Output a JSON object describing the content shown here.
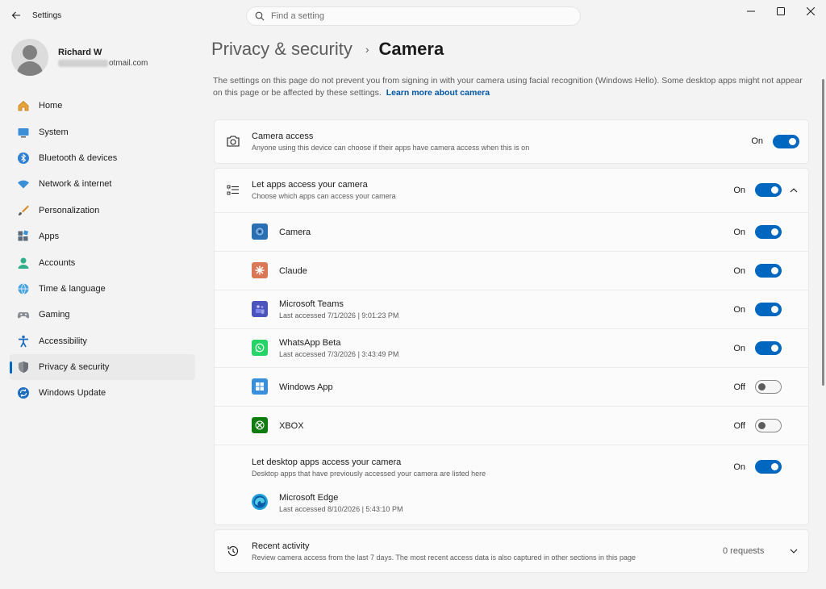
{
  "window": {
    "title": "Settings",
    "search_placeholder": "Find a setting"
  },
  "profile": {
    "name": "Richard W",
    "email_visible": "otmail.com"
  },
  "sidebar": {
    "items": [
      {
        "label": "Home",
        "icon": "home-icon"
      },
      {
        "label": "System",
        "icon": "monitor-icon"
      },
      {
        "label": "Bluetooth & devices",
        "icon": "bluetooth-icon"
      },
      {
        "label": "Network & internet",
        "icon": "wifi-icon"
      },
      {
        "label": "Personalization",
        "icon": "brush-icon"
      },
      {
        "label": "Apps",
        "icon": "apps-icon"
      },
      {
        "label": "Accounts",
        "icon": "accounts-icon"
      },
      {
        "label": "Time & language",
        "icon": "globe-icon"
      },
      {
        "label": "Gaming",
        "icon": "gamepad-icon"
      },
      {
        "label": "Accessibility",
        "icon": "accessibility-icon"
      },
      {
        "label": "Privacy & security",
        "icon": "shield-icon",
        "active": true
      },
      {
        "label": "Windows Update",
        "icon": "update-icon"
      }
    ]
  },
  "header": {
    "parent": "Privacy & security",
    "separator": "›",
    "current": "Camera"
  },
  "description": {
    "text": "The settings on this page do not prevent you from signing in with your camera using facial recognition (Windows Hello). Some desktop apps might not appear on this page or be affected by these settings.",
    "link": "Learn more about camera"
  },
  "camera_access": {
    "title": "Camera access",
    "desc": "Anyone using this device can choose if their apps have camera access when this is on",
    "state": "On"
  },
  "let_apps": {
    "title": "Let apps access your camera",
    "desc": "Choose which apps can access your camera",
    "state": "On"
  },
  "apps": [
    {
      "name": "Camera",
      "sub": "",
      "state": "On"
    },
    {
      "name": "Claude",
      "sub": "",
      "state": "On"
    },
    {
      "name": "Microsoft Teams",
      "sub": "Last accessed 7/1/2026  |  9:01:23 PM",
      "state": "On"
    },
    {
      "name": "WhatsApp Beta",
      "sub": "Last accessed 7/3/2026  |  3:43:49 PM",
      "state": "On"
    },
    {
      "name": "Windows App",
      "sub": "",
      "state": "Off"
    },
    {
      "name": "XBOX",
      "sub": "",
      "state": "Off"
    }
  ],
  "desktop_apps": {
    "title": "Let desktop apps access your camera",
    "desc": "Desktop apps that have previously accessed your camera are listed here",
    "state": "On",
    "app_name": "Microsoft Edge",
    "app_sub": "Last accessed 8/10/2026  |  5:43:10 PM"
  },
  "recent": {
    "title": "Recent activity",
    "desc": "Review camera access from the last 7 days. The most recent access data is also captured in other sections in this page",
    "count": "0 requests"
  },
  "colors": {
    "accent": "#0067c0",
    "background": "#f3f3f3",
    "card": "#fbfbfb"
  }
}
